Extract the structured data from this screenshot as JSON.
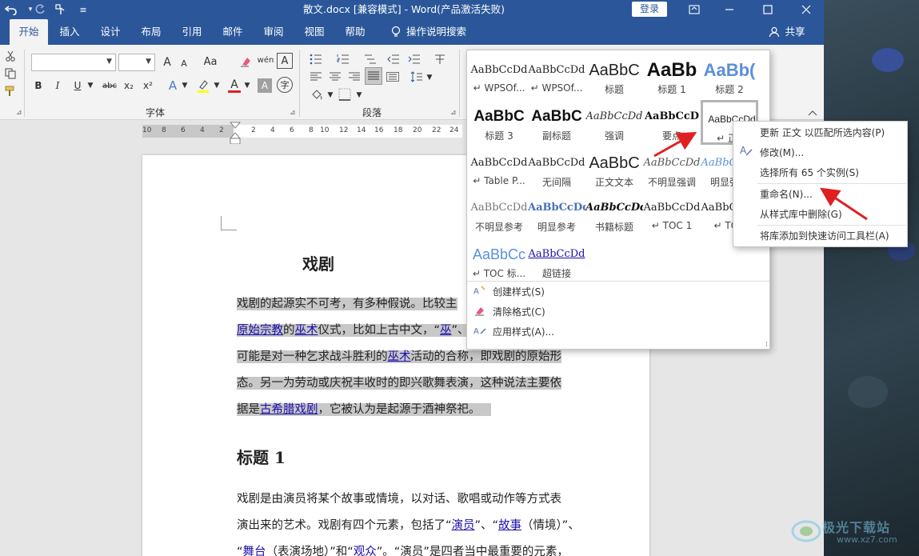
{
  "titlebar": {
    "title": "散文.docx [兼容模式]  -  Word(产品激活失败)",
    "login_label": "登录",
    "undo_icon": "undo-icon",
    "redo_icon": "redo-icon",
    "touch_icon": "touch-mode-icon",
    "customize_icon": "customize-qat-icon"
  },
  "tabs": [
    "开始",
    "插入",
    "设计",
    "布局",
    "引用",
    "邮件",
    "审阅",
    "视图",
    "帮助"
  ],
  "tell_me": "操作说明搜索",
  "share_label": "共享",
  "ribbon": {
    "font_group_label": "字体",
    "paragraph_group_label": "段落",
    "font_name": "",
    "font_size": "",
    "grow_font": "A",
    "shrink_font": "A",
    "change_case": "Aa",
    "bold": "B",
    "italic": "I",
    "underline": "U",
    "strikethrough": "abc",
    "subscript": "x₂",
    "superscript": "x²",
    "text_effect": "A",
    "font_color": "A",
    "char_shading": "A",
    "pinyin": "wén",
    "enclose": "字"
  },
  "ruler": {
    "numbers": [
      "10",
      "8",
      "6",
      "4",
      "2",
      "2",
      "4",
      "6",
      "8",
      "10",
      "12",
      "14",
      "16",
      "18",
      "20",
      "22",
      "24"
    ]
  },
  "document": {
    "title": "戏剧",
    "p1_lines": [
      [
        {
          "t": "戏剧的起源实不可考，有多种假说。比较主"
        }
      ],
      [
        {
          "t": "原始宗教",
          "link": true
        },
        {
          "t": "的"
        },
        {
          "t": "巫术",
          "link": true
        },
        {
          "t": "仪式，比如上古中文，“"
        },
        {
          "t": "巫",
          "link": true
        },
        {
          "t": "”、“"
        }
      ],
      [
        {
          "t": "可能是对一种乞求战斗胜利的"
        },
        {
          "t": "巫术",
          "link": true
        },
        {
          "t": "活动的合称，即戏剧的原始形"
        }
      ],
      [
        {
          "t": "态。另一为劳动或庆祝丰收时的即兴歌舞表演，这种说法主要依"
        }
      ],
      [
        {
          "t": "据是"
        },
        {
          "t": "古希腊戏剧",
          "link": true
        },
        {
          "t": "，它被认为是起源于酒神祭祀。"
        }
      ]
    ],
    "heading1": "标题 1",
    "p2_lines": [
      [
        {
          "t": "戏剧是由演员将某个故事或情境，以对话、歌唱或动作等方式表"
        }
      ],
      [
        {
          "t": "演出来的艺术。戏剧有四个元素，包括了“"
        },
        {
          "t": "演员",
          "link": true
        },
        {
          "t": "”、“"
        },
        {
          "t": "故事",
          "link": true
        },
        {
          "t": "（情境）”、"
        }
      ],
      [
        {
          "t": "“"
        },
        {
          "t": "舞台",
          "link": true
        },
        {
          "t": "（表演场地）”和“"
        },
        {
          "t": "观众",
          "link": true
        },
        {
          "t": "”。“演员”是四者当中最重要的元素，"
        }
      ]
    ]
  },
  "gallery": {
    "styles": [
      {
        "preview": "AaBbCcDd",
        "name": "↵ WPSOf...",
        "font": "serif",
        "size": 13,
        "weight": "normal",
        "color": "#222"
      },
      {
        "preview": "AaBbCcDd",
        "name": "↵ WPSOf...",
        "font": "serif",
        "size": 13,
        "weight": "normal",
        "color": "#222"
      },
      {
        "preview": "AaBbC",
        "name": "标题",
        "font": "sans",
        "size": 20,
        "weight": "normal",
        "color": "#222"
      },
      {
        "preview": "AaBb",
        "name": "标题 1",
        "font": "sans",
        "size": 24,
        "weight": "bold",
        "color": "#111"
      },
      {
        "preview": "AaBb(",
        "name": "标题 2",
        "font": "sans",
        "size": 22,
        "weight": "bold",
        "color": "#5b8fd8"
      },
      {
        "preview": "AaBbC",
        "name": "标题 3",
        "font": "sans",
        "size": 19,
        "weight": "bold",
        "color": "#111"
      },
      {
        "preview": "AaBbC",
        "name": "副标题",
        "font": "sans",
        "size": 19,
        "weight": "bold",
        "color": "#111"
      },
      {
        "preview": "AaBbCcDd",
        "name": "强调",
        "font": "serif-italic",
        "size": 13,
        "weight": "normal",
        "color": "#333"
      },
      {
        "preview": "AaBbCcD",
        "name": "要点",
        "font": "serif",
        "size": 13,
        "weight": "bold",
        "color": "#111"
      },
      {
        "preview": "AaBbCcDd",
        "name": "↵ 正文",
        "font": "sans",
        "size": 12,
        "weight": "normal",
        "color": "#222",
        "selected": true
      },
      {
        "preview": "AaBbCcDd",
        "name": "↵ Table P...",
        "font": "serif",
        "size": 13,
        "weight": "normal",
        "color": "#222"
      },
      {
        "preview": "AaBbCcDd",
        "name": "无间隔",
        "font": "serif",
        "size": 13,
        "weight": "normal",
        "color": "#222"
      },
      {
        "preview": "AaBbC",
        "name": "正文文本",
        "font": "sans",
        "size": 20,
        "weight": "normal",
        "color": "#222"
      },
      {
        "preview": "AaBbCcDd",
        "name": "不明显强调",
        "font": "serif-italic",
        "size": 13,
        "weight": "normal",
        "color": "#555"
      },
      {
        "preview": "AaBbCcDd",
        "name": "明显强调",
        "font": "serif-italic",
        "size": 13,
        "weight": "normal",
        "color": "#5b8fd8"
      },
      {
        "preview": "AaBbCcDd",
        "name": "不明显参考",
        "font": "serif",
        "size": 13,
        "weight": "normal",
        "color": "#777"
      },
      {
        "preview": "AaBbCcDd",
        "name": "明显参考",
        "font": "serif",
        "size": 13,
        "weight": "bold",
        "color": "#4a6fb5"
      },
      {
        "preview": "AaBbCcDd",
        "name": "书籍标题",
        "font": "serif-italic",
        "size": 13,
        "weight": "bold",
        "color": "#111"
      },
      {
        "preview": "AaBbCcDd",
        "name": "↵ TOC 1",
        "font": "serif",
        "size": 13,
        "weight": "normal",
        "color": "#222"
      },
      {
        "preview": "AaBbCcDd",
        "name": "↵ TOC",
        "font": "serif",
        "size": 13,
        "weight": "normal",
        "color": "#222"
      },
      {
        "preview": "AaBbCc",
        "name": "↵ TOC 标...",
        "font": "sans",
        "size": 18,
        "weight": "normal",
        "color": "#5b8fd8"
      },
      {
        "preview": "AaBbCcDd",
        "name": "超链接",
        "font": "serif",
        "size": 13,
        "weight": "normal",
        "color": "#1a0dab",
        "underline": true
      }
    ],
    "commands": [
      {
        "label": "创建样式(S)",
        "icon": "create-style-icon"
      },
      {
        "label": "清除格式(C)",
        "icon": "clear-format-icon"
      },
      {
        "label": "应用样式(A)...",
        "icon": "apply-styles-icon"
      }
    ]
  },
  "context_menu": {
    "items": [
      "更新 正文 以匹配所选内容(P)",
      "修改(M)...",
      "选择所有 65 个实例(S)",
      "重命名(N)...",
      "从样式库中删除(G)",
      "将库添加到快速访问工具栏(A)"
    ]
  },
  "watermark": {
    "text": "极光下载站",
    "url": "www.xz7.com"
  },
  "colors": {
    "accent": "#2b579a",
    "arrow": "#e02020",
    "highlight": "#c8c8c8",
    "link": "#1a0dab"
  }
}
